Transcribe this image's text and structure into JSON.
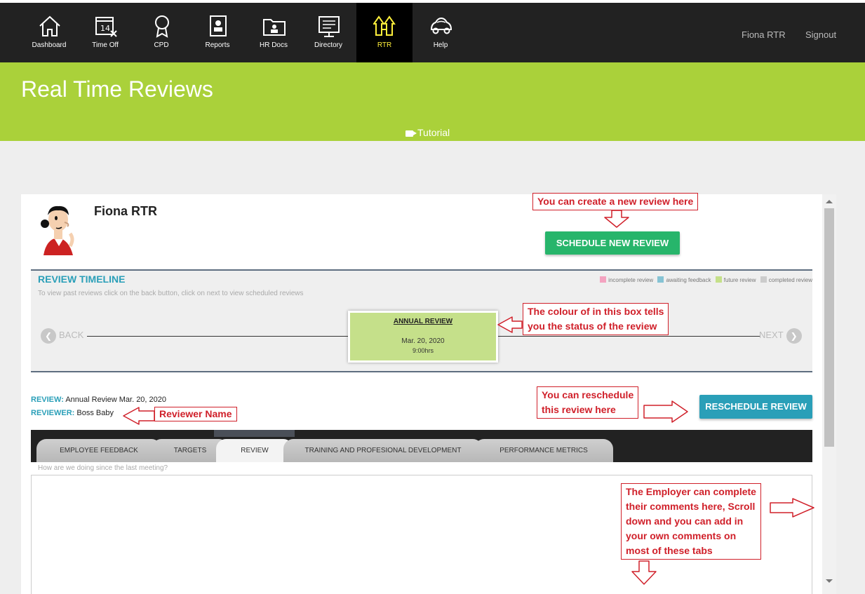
{
  "nav": {
    "items": [
      {
        "label": "Dashboard",
        "icon": "house-icon"
      },
      {
        "label": "Time Off",
        "icon": "calendar-icon"
      },
      {
        "label": "CPD",
        "icon": "award-ribbon-icon"
      },
      {
        "label": "Reports",
        "icon": "report-icon"
      },
      {
        "label": "HR Docs",
        "icon": "folder-icon"
      },
      {
        "label": "Directory",
        "icon": "directory-icon"
      },
      {
        "label": "RTR",
        "icon": "rtr-arrows-icon"
      },
      {
        "label": "Help",
        "icon": "car-icon"
      }
    ],
    "active": "RTR",
    "calendar_day": "14",
    "user_name": "Fiona RTR",
    "signout_label": "Signout"
  },
  "header": {
    "title": "Real Time Reviews",
    "tutorial_label": "Tutorial"
  },
  "employee": {
    "name": "Fiona RTR",
    "schedule_button": "SCHEDULE NEW REVIEW"
  },
  "timeline": {
    "title": "REVIEW TIMELINE",
    "subtitle": "To view past reviews click on the back button, click on next to view scheduled reviews",
    "legend": [
      {
        "label": "incomplete review",
        "color": "#f4a3c0"
      },
      {
        "label": "awaiting feedback",
        "color": "#86c3d4"
      },
      {
        "label": "future review",
        "color": "#c5e08a"
      },
      {
        "label": "completed review",
        "color": "#cccccc"
      }
    ],
    "back_label": "BACK",
    "next_label": "NEXT",
    "review_box": {
      "title": "ANNUAL REVIEW",
      "date": "Mar. 20, 2020",
      "time": "9:00hrs",
      "status_color": "#c5e08a"
    }
  },
  "review": {
    "review_label": "REVIEW:",
    "review_value": "Annual Review Mar. 20, 2020",
    "reviewer_label": "REVIEWER:",
    "reviewer_value": "Boss Baby",
    "reschedule_button": "RESCHEDULE REVIEW"
  },
  "tabs": [
    {
      "label": "EMPLOYEE FEEDBACK"
    },
    {
      "label": "TARGETS"
    },
    {
      "label": "REVIEW"
    },
    {
      "label": "TRAINING AND PROFESIONAL DEVELOPMENT"
    },
    {
      "label": "PERFORMANCE METRICS"
    }
  ],
  "active_tab": "REVIEW",
  "question": "How are we doing since the last meeting?",
  "annotations": {
    "create": "You can create a new review here",
    "status": [
      "The colour of in this box tells",
      "you the status of the review"
    ],
    "reschedule": [
      "You can reschedule",
      "this review here"
    ],
    "reviewer": "Reviewer Name",
    "employer": [
      "The Employer can complete",
      "their comments here, Scroll",
      "down and you can add in",
      "your own comments on",
      "most of these tabs"
    ]
  },
  "colors": {
    "nav_bg": "#222222",
    "header_green": "#aad13a",
    "schedule_green": "#27b56b",
    "reschedule_teal": "#2a9fb8",
    "annotation_red": "#d0202a",
    "active_nav_text": "#ffef3b"
  }
}
